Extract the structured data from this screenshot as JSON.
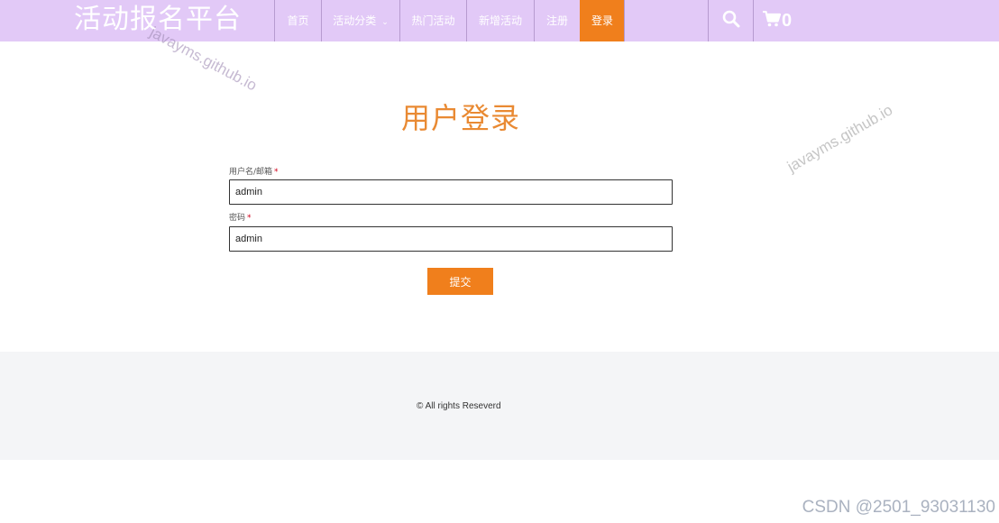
{
  "header": {
    "brand": "活动报名平台",
    "nav": [
      {
        "label": "首页",
        "name": "nav-home",
        "width": 52
      },
      {
        "label": "活动分类",
        "name": "nav-category",
        "width": 87,
        "caret": "⌄"
      },
      {
        "label": "热门活动",
        "name": "nav-hot-events",
        "width": 74
      },
      {
        "label": "新增活动",
        "name": "nav-new-events",
        "width": 75
      },
      {
        "label": "注册",
        "name": "nav-register",
        "width": 51
      },
      {
        "label": "登录",
        "name": "nav-login",
        "width": 50,
        "active": true
      }
    ],
    "search_icon": "search-icon",
    "cart_icon": "cart-icon",
    "cart_count": "0"
  },
  "watermarks": {
    "header": "javayms.github.io",
    "side": "javayms.github.io"
  },
  "login": {
    "title": "用户登录",
    "username_label": "用户名/邮箱",
    "username_value": "admin",
    "password_label": "密码",
    "password_value": "admin",
    "required_mark": "*",
    "submit_label": "提交"
  },
  "footer": {
    "copyright": "© All rights Reseverd"
  },
  "csdn_watermark": "CSDN @2501_93031130",
  "colors": {
    "header_bg": "#e2c9f7",
    "accent": "#f07f1c",
    "title": "#e98a33",
    "footer_bg": "#f4f5f7"
  }
}
